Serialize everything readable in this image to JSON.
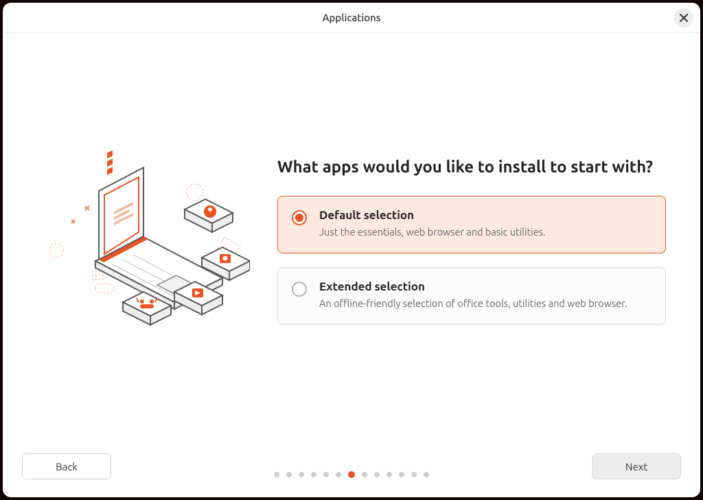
{
  "title": "Applications",
  "heading": "What apps would you like to install to start with?",
  "options": [
    {
      "title": "Default selection",
      "desc": "Just the essentials, web browser and basic utilities.",
      "selected": true
    },
    {
      "title": "Extended selection",
      "desc": "An offline-friendly selection of office tools, utilities and web browser.",
      "selected": false
    }
  ],
  "buttons": {
    "back": "Back",
    "next": "Next"
  },
  "progress": {
    "total": 13,
    "current": 7
  },
  "colors": {
    "accent": "#e95420"
  }
}
